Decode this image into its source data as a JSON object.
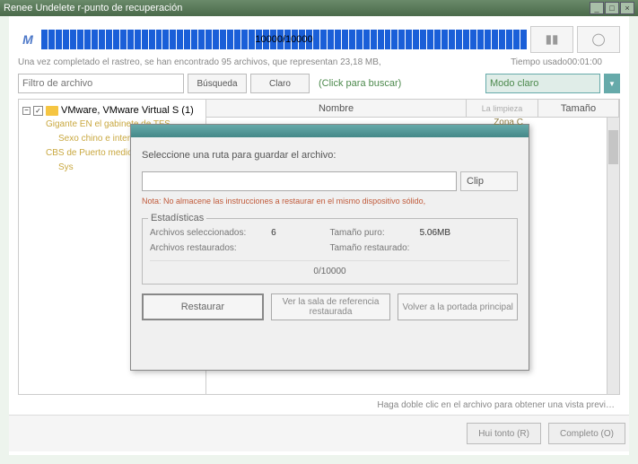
{
  "titlebar": {
    "title": "Renee Undelete r-punto de recuperación"
  },
  "progress": {
    "text": "10000/10000"
  },
  "scan": {
    "summary": "Una vez completado el rastreo, se han encontrado 95 archivos, que representan 23,18 MB,",
    "time_label": "Tiempo usado",
    "time_value": "00:01:00"
  },
  "filter": {
    "placeholder": "Filtro de archivo",
    "search_btn": "Búsqueda",
    "clear_btn": "Claro",
    "hint": "(Click para buscar)",
    "mode": "Modo claro"
  },
  "tree": {
    "root": "VMware, VMware Virtual S (1)",
    "items": [
      "Gigante EN el gabinete de TFS",
      "Sexo chino e internacional",
      "CBS de Puerto medio",
      "Sys"
    ]
  },
  "list_head": {
    "name": "Nombre",
    "mid": "La limpieza",
    "size": "Tamaño"
  },
  "modal": {
    "zone": "Zona C",
    "prompt": "Seleccione una ruta para guardar el archivo:",
    "clip": "Clip",
    "note": "Nota: No almacene las instrucciones a restaurar en el mismo dispositivo sólido,",
    "stats_title": "Estadísticas",
    "selected_label": "Archivos seleccionados:",
    "selected_val": "6",
    "size_label": "Tamaño puro:",
    "size_val": "5.06MB",
    "restored_label": "Archivos restaurados:",
    "restored_size_label": "Tamaño restaurado:",
    "progress": "0/10000",
    "restore_btn": "Restaurar",
    "ref_btn": "Ver la sala de referencia restaurada",
    "back_btn": "Volver a la portada principal"
  },
  "footer": {
    "hint": "Haga doble clic en el archivo para obtener una vista previ…",
    "hui": "Hui tonto (R)",
    "complete": "Completo (O)"
  }
}
